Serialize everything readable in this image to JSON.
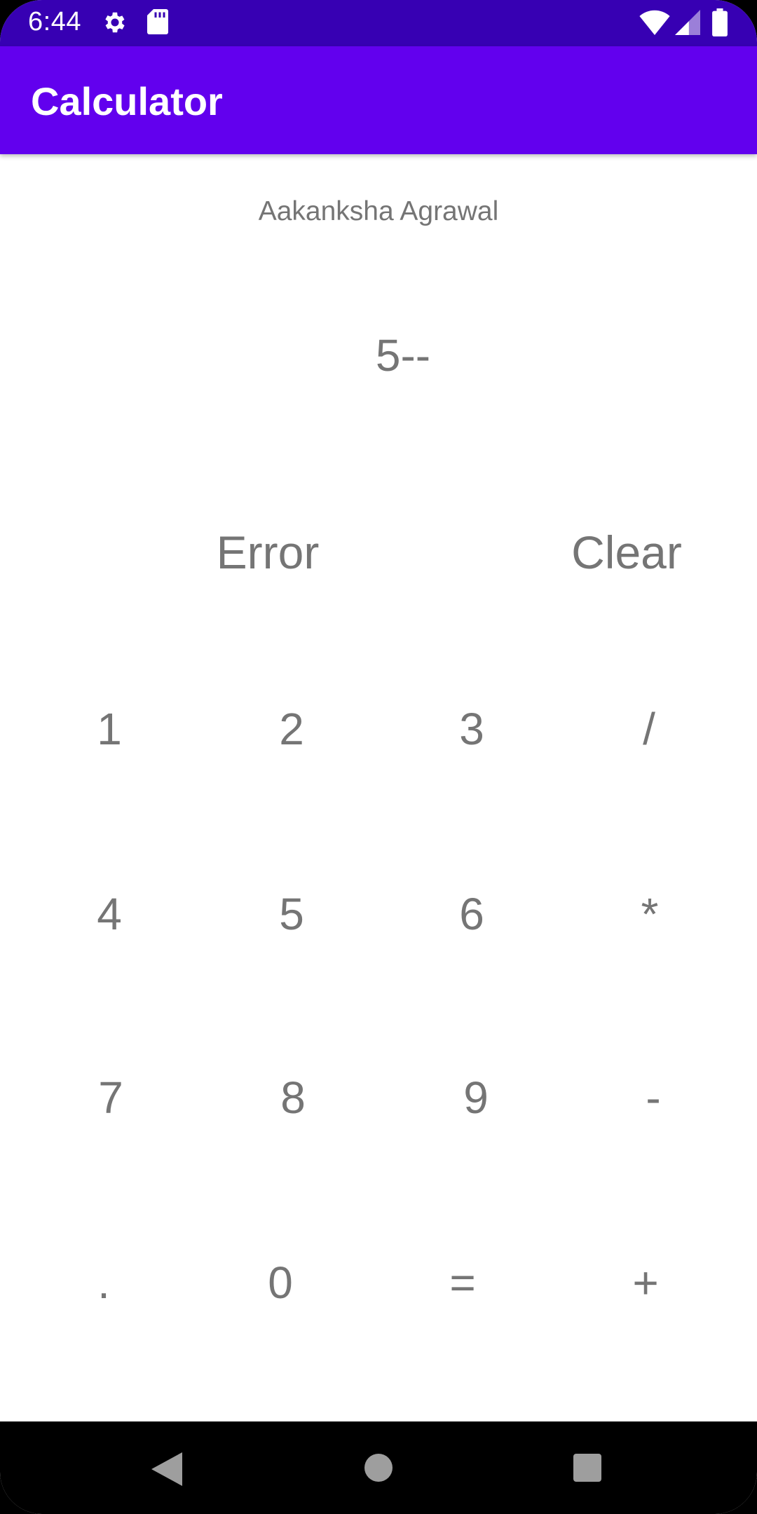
{
  "status_bar": {
    "time": "6:44",
    "icons": [
      "settings-icon",
      "sd-card-icon",
      "wifi-icon",
      "signal-icon",
      "battery-icon"
    ]
  },
  "app_bar": {
    "title": "Calculator"
  },
  "author": "Aakanksha Agrawal",
  "display": "5--",
  "function_keys": {
    "error": "Error",
    "clear": "Clear"
  },
  "keys": {
    "row1": [
      "1",
      "2",
      "3",
      "/"
    ],
    "row2": [
      "4",
      "5",
      "6",
      "*"
    ],
    "row3": [
      "7",
      "8",
      "9",
      "-"
    ],
    "row4": [
      ".",
      "0",
      "=",
      "+"
    ]
  },
  "nav_bar": {
    "icons": [
      "back-icon",
      "home-icon",
      "recents-icon"
    ]
  },
  "colors": {
    "status_bar": "#3700b3",
    "app_bar": "#6200ee",
    "key_text": "#757575",
    "background": "#ffffff"
  }
}
